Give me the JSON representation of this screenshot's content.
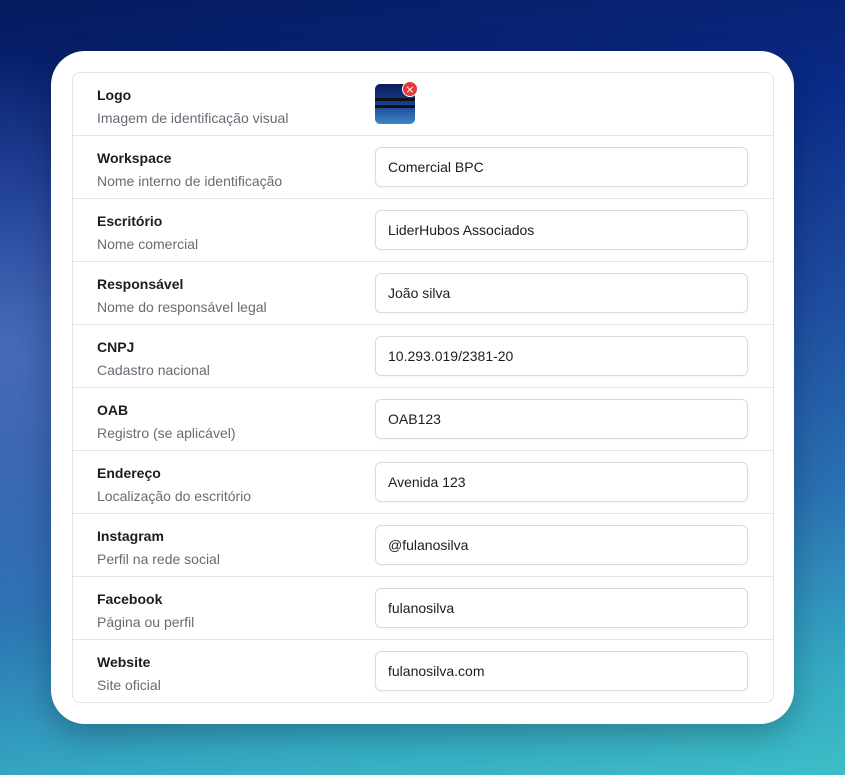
{
  "form": {
    "logo": {
      "title": "Logo",
      "subtitle": "Imagem de identificação visual",
      "remove_icon": "×"
    },
    "rows": [
      {
        "title": "Workspace",
        "subtitle": "Nome interno de identificação",
        "value": "Comercial BPC"
      },
      {
        "title": "Escritório",
        "subtitle": "Nome comercial",
        "value": "LiderHubos Associados"
      },
      {
        "title": "Responsável",
        "subtitle": "Nome do responsável legal",
        "value": "João silva"
      },
      {
        "title": "CNPJ",
        "subtitle": "Cadastro nacional",
        "value": "10.293.019/2381-20"
      },
      {
        "title": "OAB",
        "subtitle": "Registro (se aplicável)",
        "value": "OAB123"
      },
      {
        "title": "Endereço",
        "subtitle": "Localização do escritório",
        "value": "Avenida 123"
      },
      {
        "title": "Instagram",
        "subtitle": "Perfil na rede social",
        "value": "@fulanosilva"
      },
      {
        "title": "Facebook",
        "subtitle": "Página ou perfil",
        "value": "fulanosilva"
      },
      {
        "title": "Website",
        "subtitle": "Site oficial",
        "value": "fulanosilva.com"
      }
    ]
  },
  "colors": {
    "remove_button": "#e23b3b",
    "border": "#e3e4e8"
  }
}
